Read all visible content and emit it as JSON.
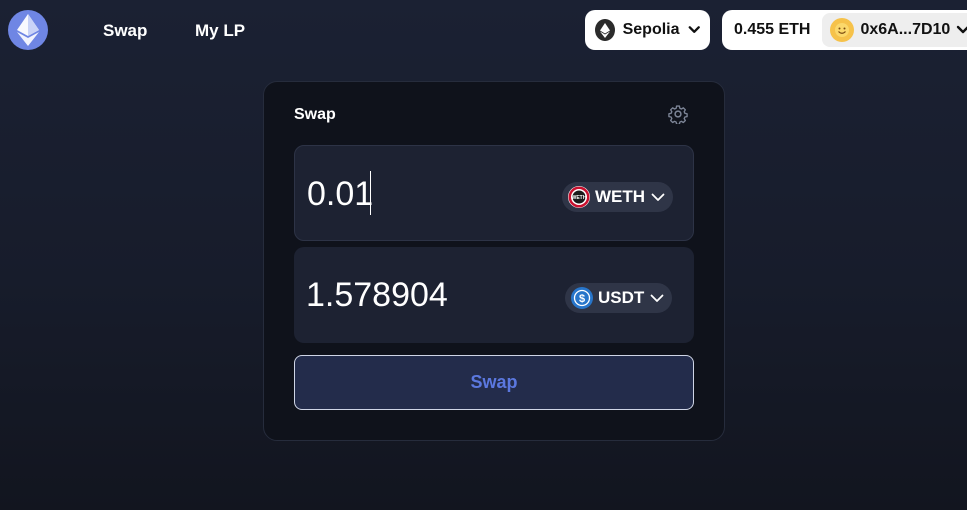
{
  "header": {
    "logo_icon": "ethereum-icon",
    "nav": [
      {
        "label": "Swap"
      },
      {
        "label": "My LP"
      }
    ],
    "network": {
      "label": "Sepolia",
      "icon": "ethereum-icon"
    },
    "account": {
      "balance": "0.455 ETH",
      "address": "0x6A...7D10"
    }
  },
  "swap_card": {
    "title": "Swap",
    "from": {
      "amount": "0.01",
      "token": "WETH"
    },
    "to": {
      "amount": "1.578904",
      "token": "USDT"
    },
    "button_label": "Swap"
  },
  "colors": {
    "accent": "#5b78df",
    "background": "#1b2133",
    "card": "#0f121b",
    "panel": "#1d2232"
  }
}
